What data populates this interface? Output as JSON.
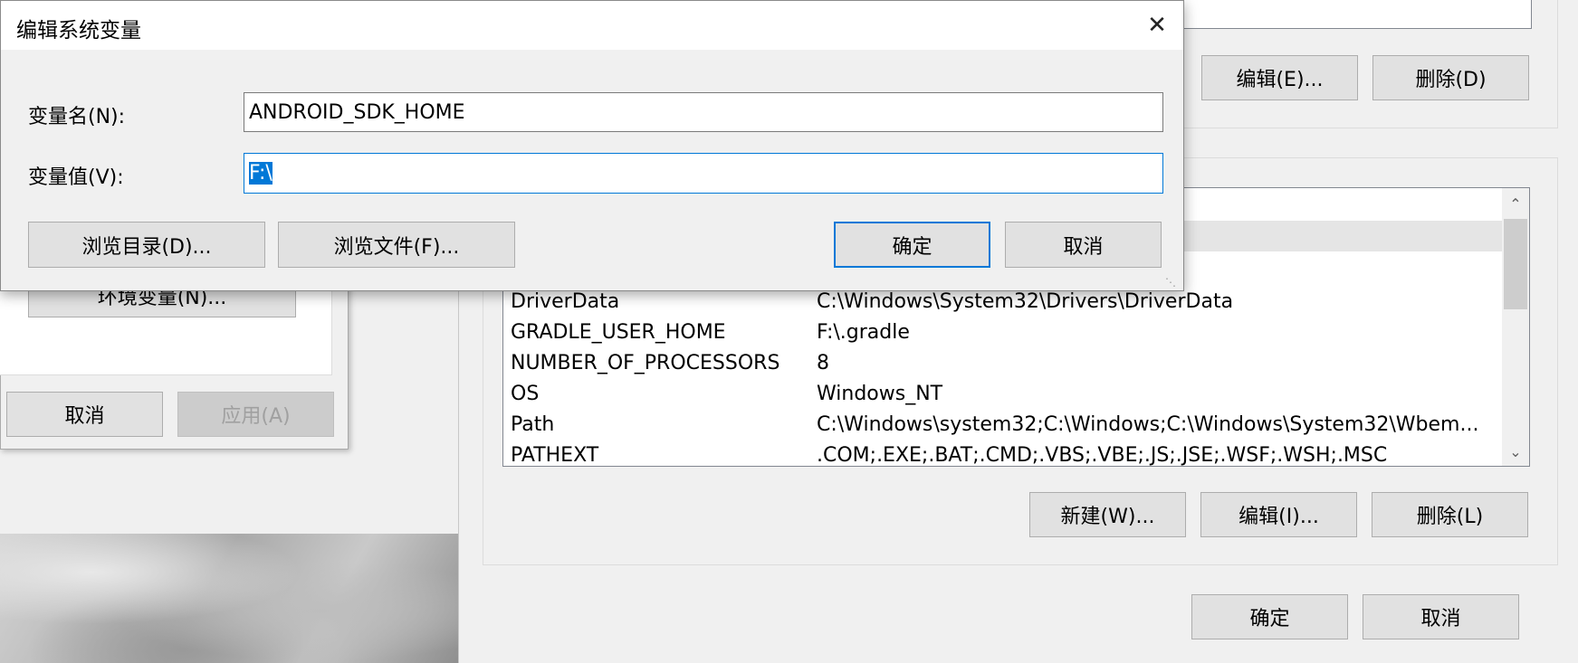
{
  "edit_dialog": {
    "title": "编辑系统变量",
    "close_glyph": "✕",
    "name_label": "变量名(N):",
    "name_value": "ANDROID_SDK_HOME",
    "value_label": "变量值(V):",
    "value_value": "F:\\",
    "browse_dir_label": "浏览目录(D)...",
    "browse_file_label": "浏览文件(F)...",
    "ok_label": "确定",
    "cancel_label": "取消"
  },
  "env_window": {
    "user_edit_label": "编辑(E)...",
    "user_delete_label": "删除(D)",
    "system_vars": {
      "rows": [
        {
          "name": "",
          "value": ""
        },
        {
          "name": "",
          "value": ""
        },
        {
          "name": "",
          "value": ""
        },
        {
          "name": "DriverData",
          "value": "C:\\Windows\\System32\\Drivers\\DriverData"
        },
        {
          "name": "GRADLE_USER_HOME",
          "value": "F:\\.gradle"
        },
        {
          "name": "NUMBER_OF_PROCESSORS",
          "value": "8"
        },
        {
          "name": "OS",
          "value": "Windows_NT"
        },
        {
          "name": "Path",
          "value": "C:\\Windows\\system32;C:\\Windows;C:\\Windows\\System32\\Wbem..."
        },
        {
          "name": "PATHEXT",
          "value": ".COM;.EXE;.BAT;.CMD;.VBS;.VBE;.JS;.JSE;.WSF;.WSH;.MSC"
        }
      ],
      "new_label": "新建(W)...",
      "edit_label": "编辑(I)...",
      "delete_label": "删除(L)"
    },
    "ok_label": "确定",
    "cancel_label": "取消"
  },
  "system_properties": {
    "env_vars_label": "环境变量(N)...",
    "cancel_label": "取消",
    "apply_label": "应用(A)"
  },
  "colors": {
    "accent": "#0078d7",
    "selection_row": "#e5e5e5"
  }
}
